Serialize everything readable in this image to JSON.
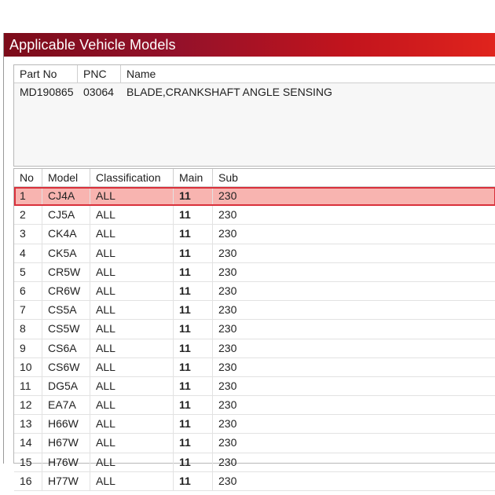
{
  "window": {
    "title": "Applicable Vehicle Models"
  },
  "part_header": {
    "col_partno": "Part No",
    "col_pnc": "PNC",
    "col_name": "Name"
  },
  "part": {
    "part_no": "MD190865",
    "pnc": "03064",
    "name": "BLADE,CRANKSHAFT ANGLE SENSING"
  },
  "grid_columns": {
    "no": "No",
    "model": "Model",
    "classification": "Classification",
    "main": "Main",
    "sub": "Sub"
  },
  "rows": [
    {
      "no": "1",
      "model": "CJ4A",
      "classification": "ALL",
      "main": "11",
      "sub": "230"
    },
    {
      "no": "2",
      "model": "CJ5A",
      "classification": "ALL",
      "main": "11",
      "sub": "230"
    },
    {
      "no": "3",
      "model": "CK4A",
      "classification": "ALL",
      "main": "11",
      "sub": "230"
    },
    {
      "no": "4",
      "model": "CK5A",
      "classification": "ALL",
      "main": "11",
      "sub": "230"
    },
    {
      "no": "5",
      "model": "CR5W",
      "classification": "ALL",
      "main": "11",
      "sub": "230"
    },
    {
      "no": "6",
      "model": "CR6W",
      "classification": "ALL",
      "main": "11",
      "sub": "230"
    },
    {
      "no": "7",
      "model": "CS5A",
      "classification": "ALL",
      "main": "11",
      "sub": "230"
    },
    {
      "no": "8",
      "model": "CS5W",
      "classification": "ALL",
      "main": "11",
      "sub": "230"
    },
    {
      "no": "9",
      "model": "CS6A",
      "classification": "ALL",
      "main": "11",
      "sub": "230"
    },
    {
      "no": "10",
      "model": "CS6W",
      "classification": "ALL",
      "main": "11",
      "sub": "230"
    },
    {
      "no": "11",
      "model": "DG5A",
      "classification": "ALL",
      "main": "11",
      "sub": "230"
    },
    {
      "no": "12",
      "model": "EA7A",
      "classification": "ALL",
      "main": "11",
      "sub": "230"
    },
    {
      "no": "13",
      "model": "H66W",
      "classification": "ALL",
      "main": "11",
      "sub": "230"
    },
    {
      "no": "14",
      "model": "H67W",
      "classification": "ALL",
      "main": "11",
      "sub": "230"
    },
    {
      "no": "15",
      "model": "H76W",
      "classification": "ALL",
      "main": "11",
      "sub": "230"
    },
    {
      "no": "16",
      "model": "H77W",
      "classification": "ALL",
      "main": "11",
      "sub": "230"
    }
  ],
  "selected_row": 0,
  "colors": {
    "title_dark": "#7c0c1a",
    "title_light": "#e0241d",
    "selection_fill": "#f8b4b0",
    "selection_border": "#d9303b"
  }
}
